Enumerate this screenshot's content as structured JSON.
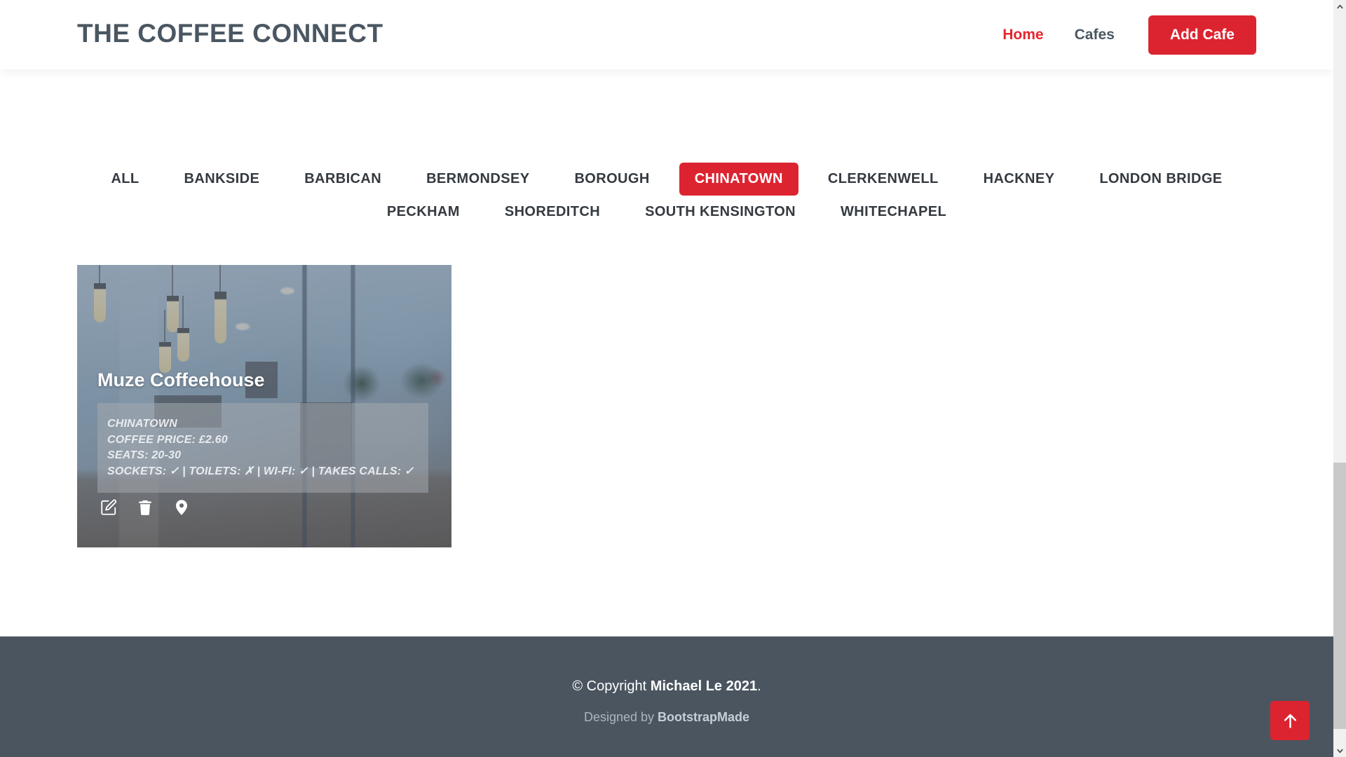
{
  "header": {
    "logo": "THE COFFEE CONNECT",
    "nav": [
      {
        "label": "Home",
        "active": true
      },
      {
        "label": "Cafes",
        "active": false
      }
    ],
    "add_cafe_label": "Add Cafe",
    "accent_color": "#dc2430",
    "logo_color": "#4a5762",
    "active_link_color": "#e8242d"
  },
  "filters": [
    {
      "label": "ALL",
      "active": false
    },
    {
      "label": "BANKSIDE",
      "active": false
    },
    {
      "label": "BARBICAN",
      "active": false
    },
    {
      "label": "BERMONDSEY",
      "active": false
    },
    {
      "label": "BOROUGH",
      "active": false
    },
    {
      "label": "CHINATOWN",
      "active": true
    },
    {
      "label": "CLERKENWELL",
      "active": false
    },
    {
      "label": "HACKNEY",
      "active": false
    },
    {
      "label": "LONDON BRIDGE",
      "active": false
    },
    {
      "label": "PECKHAM",
      "active": false
    },
    {
      "label": "SHOREDITCH",
      "active": false
    },
    {
      "label": "SOUTH KENSINGTON",
      "active": false
    },
    {
      "label": "WHITECHAPEL",
      "active": false
    }
  ],
  "cafes": [
    {
      "name": "Muze Coffeehouse",
      "area": "CHINATOWN",
      "price_line": "COFFEE PRICE: £2.60",
      "seats_line": "SEATS: 20-30",
      "amenities_line": "SOCKETS: ✓ | TOILETS: ✗ | WI-FI: ✓ | TAKES CALLS: ✓",
      "actions": [
        {
          "icon": "edit-icon",
          "title": "Edit"
        },
        {
          "icon": "trash-icon",
          "title": "Delete"
        },
        {
          "icon": "map-pin-icon",
          "title": "Map"
        }
      ]
    }
  ],
  "footer": {
    "copyright_prefix": "© Copyright ",
    "copyright_owner": "Michael Le 2021",
    "copyright_suffix": ".",
    "credits_prefix": "Designed by ",
    "credits_link": "BootstrapMade",
    "background_color": "#4a5560"
  },
  "back_to_top": {
    "icon": "arrow-up-icon",
    "color": "#dc2430"
  },
  "scrollbar": {
    "up_icon": "chevron-up-icon",
    "down_icon": "chevron-down-icon"
  }
}
